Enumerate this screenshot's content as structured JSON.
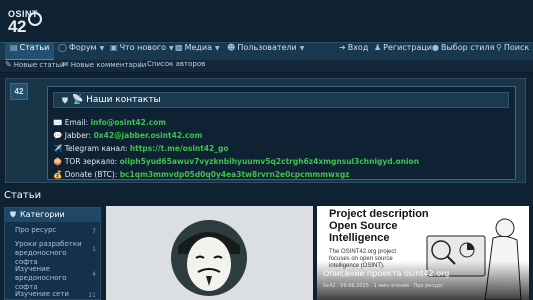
{
  "logo": {
    "line1": "OSINT",
    "line2": "42"
  },
  "nav": {
    "items": [
      {
        "label": "Статьи",
        "icon": "articles-icon",
        "active": true
      },
      {
        "label": "Форум",
        "icon": "forum-icon"
      },
      {
        "label": "Что нового",
        "icon": "whats-new-icon"
      },
      {
        "label": "Медиа",
        "icon": "media-icon"
      },
      {
        "label": "Пользователи",
        "icon": "users-icon"
      }
    ],
    "right": [
      {
        "label": "Вход",
        "icon": "login-icon"
      },
      {
        "label": "Регистрация",
        "icon": "register-icon"
      },
      {
        "label": "Выбор стиля",
        "icon": "style-icon"
      },
      {
        "label": "Поиск",
        "icon": "search-icon"
      }
    ]
  },
  "subnav": {
    "items": [
      {
        "label": "Новые статьи",
        "icon": "edit-icon"
      },
      {
        "label": "Новые комментарии",
        "icon": "comments-icon"
      },
      {
        "label": "Список авторов"
      }
    ]
  },
  "notice": {
    "avatar_text": "42",
    "title": "📡 Наши контакты",
    "lines": [
      {
        "emoji": "✉️",
        "label": "Email:",
        "value": "info@osint42.com"
      },
      {
        "emoji": "💬",
        "label": "Jabber:",
        "value": "0x42@jabber.osint42.com"
      },
      {
        "emoji": "✈️",
        "label": "Telegram канал:",
        "value": "https://t.me/osint42_go"
      },
      {
        "emoji": "🧅",
        "label": "TOR зеркало:",
        "value": "oiiph5yud65awuv7vyzknbihyuumv5q2ctrgh6z4xmgnsul3chnigyd.onion"
      },
      {
        "emoji": "💰",
        "label": "Donate (BTC):",
        "value": "bc1qm3mmvdp05d0q0y4ea3tw8rvrn2e0cpcmmmwxgz"
      }
    ]
  },
  "section_title": "Статьи",
  "categories": {
    "header": "Категории",
    "items": [
      {
        "label": "Про ресурс",
        "count": "7"
      },
      {
        "label": "Уроки разработки вредоносного софта",
        "count": "1"
      },
      {
        "label": "Изучение вредоносного софта",
        "count": "4"
      },
      {
        "label": "Изучение сети",
        "count": "11"
      }
    ]
  },
  "cards": [
    {
      "alt": "anonymous-mask"
    },
    {
      "image_title": "Project description Open Source Intelligence",
      "image_text": "The OSINT42.org project focuses on open source intelligence (OSINT).",
      "caption": "Описание проекта osint42.org",
      "meta": "0x42 · 09.06.2025 · 1 мин чтения · Про ресурс"
    }
  ],
  "colors": {
    "background": "#0f2231",
    "accent": "#4c8dbf",
    "link_green": "#3ec24f"
  }
}
